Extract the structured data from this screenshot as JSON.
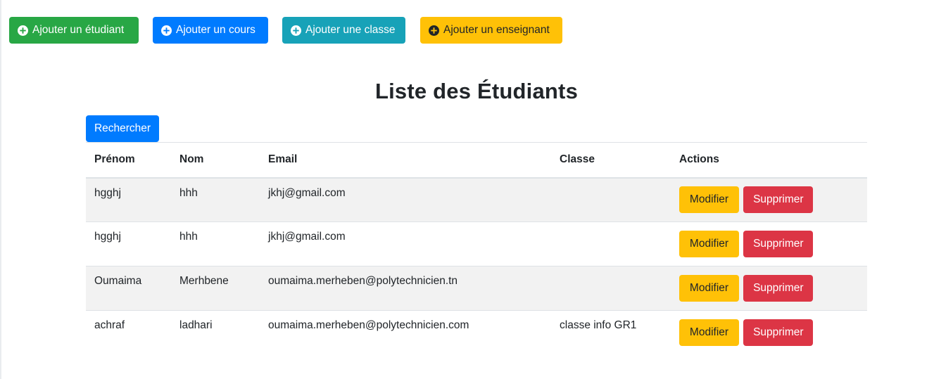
{
  "toolbar": {
    "add_student": "Ajouter un étudiant",
    "add_course": "Ajouter un cours",
    "add_class": "Ajouter une classe",
    "add_teacher": "Ajouter un enseignant"
  },
  "page": {
    "title": "Liste des Étudiants",
    "search_label": "Rechercher"
  },
  "table": {
    "headers": {
      "prenom": "Prénom",
      "nom": "Nom",
      "email": "Email",
      "classe": "Classe",
      "actions": "Actions"
    },
    "rows": [
      {
        "prenom": "hgghj",
        "nom": "hhh",
        "email": "jkhj@gmail.com",
        "classe": ""
      },
      {
        "prenom": "hgghj",
        "nom": "hhh",
        "email": "jkhj@gmail.com",
        "classe": ""
      },
      {
        "prenom": "Oumaima",
        "nom": "Merhbene",
        "email": "oumaima.merheben@polytechnicien.tn",
        "classe": ""
      },
      {
        "prenom": "achraf",
        "nom": "ladhari",
        "email": "oumaima.merheben@polytechnicien.com",
        "classe": "classe info GR1"
      }
    ],
    "modify_label": "Modifier",
    "delete_label": "Supprimer"
  },
  "colors": {
    "success": "#28a745",
    "primary": "#007bff",
    "info": "#17a2b8",
    "warning": "#ffc107",
    "danger": "#dc3545"
  },
  "icons": [
    "plus-circle-icon"
  ]
}
